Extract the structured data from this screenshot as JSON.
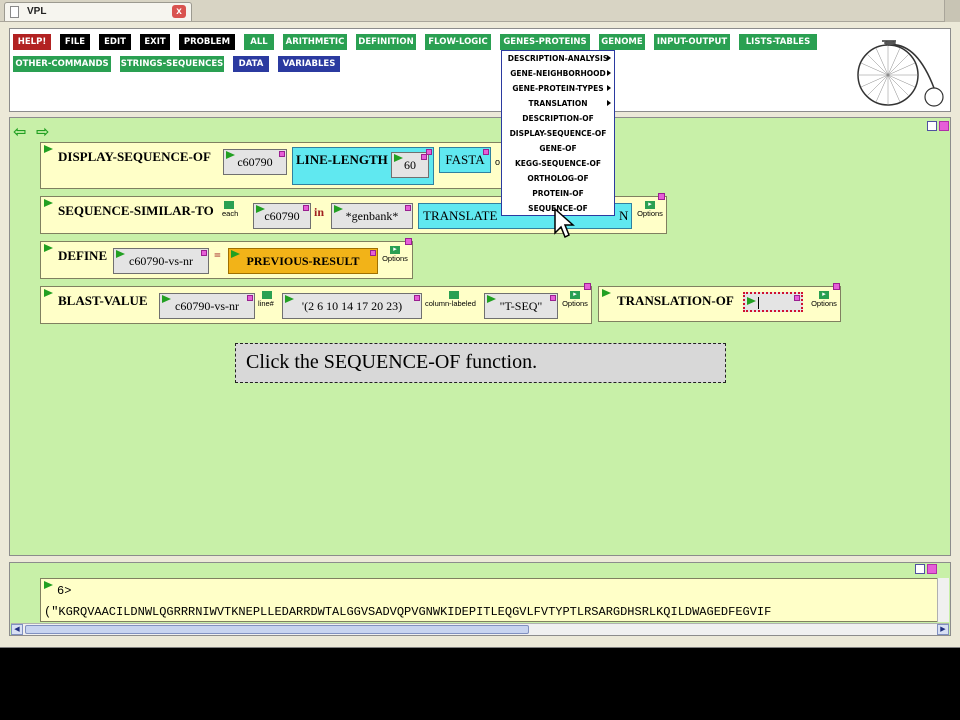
{
  "tab": {
    "title": "VPL",
    "close": "x"
  },
  "menu": {
    "row1": [
      "HELP!",
      "FILE",
      "EDIT",
      "EXIT",
      "PROBLEM",
      "ALL",
      "ARITHMETIC",
      "DEFINITION",
      "FLOW-LOGIC",
      "GENES-PROTEINS",
      "GENOME",
      "INPUT-OUTPUT",
      "LISTS-TABLES"
    ],
    "row2": [
      "OTHER-COMMANDS",
      "STRINGS-SEQUENCES",
      "DATA",
      "VARIABLES"
    ]
  },
  "dropdown": {
    "items": [
      "DESCRIPTION-ANALYSIS",
      "GENE-NEIGHBORHOOD",
      "GENE-PROTEIN-TYPES",
      "TRANSLATION",
      "DESCRIPTION-OF",
      "DISPLAY-SEQUENCE-OF",
      "GENE-OF",
      "KEGG-SEQUENCE-OF",
      "ORTHOLOG-OF",
      "PROTEIN-OF",
      "SEQUENCE-OF"
    ]
  },
  "blocks": {
    "display": {
      "name": "DISPLAY-SEQUENCE-OF",
      "arg": "c60790",
      "ll": "LINE-LENGTH",
      "llval": "60",
      "fasta": "FASTA",
      "more": "o"
    },
    "similar": {
      "name": "SEQUENCE-SIMILAR-TO",
      "each": "each",
      "arg": "c60790",
      "in": "in",
      "db": "*genbank*",
      "translate": "TRANSLATE",
      "translate_tail": "N",
      "options": "Options"
    },
    "define": {
      "name": "DEFINE",
      "var": "c60790-vs-nr",
      "eq": "=",
      "value": "PREVIOUS-RESULT",
      "options": "Options"
    },
    "blast": {
      "name": "BLAST-VALUE",
      "arg": "c60790-vs-nr",
      "line": "line#",
      "list": "'(2 6 10 14 17 20 23)",
      "col": "column-labeled",
      "seq": "\"T-SEQ\"",
      "options": "Options"
    },
    "transl": {
      "name": "TRANSLATION-OF",
      "options": "Options"
    }
  },
  "hint": "Click the SEQUENCE-OF function.",
  "results": {
    "line1": "6>",
    "line2": "(\"KGRQVAACILDNWLQGRRRNIWVTKNEPLLEDARRDWTALGGVSADVQPVGNWKIDEPITLEQGVLFVTYPTLRSARGDHSRLKQILDWAGEDFEGVIF"
  },
  "colors": {
    "workspace": "#c8f0a8",
    "block": "#ffffc8",
    "accent_green": "#2aa052",
    "accent_blue": "#2b3aa0",
    "help_red": "#b22222"
  }
}
